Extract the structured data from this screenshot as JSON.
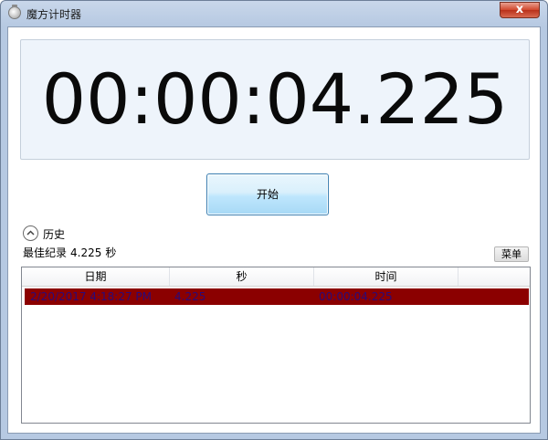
{
  "window": {
    "title": "魔方计时器",
    "close_glyph": "x"
  },
  "timer": {
    "display": "00:00:04.225"
  },
  "controls": {
    "start_label": "开始",
    "menu_label": "菜单"
  },
  "history": {
    "label": "历史",
    "best_prefix": "最佳纪录",
    "best_value": "4.225",
    "best_unit": "秒"
  },
  "table": {
    "columns": [
      "日期",
      "秒",
      "时间"
    ],
    "rows": [
      {
        "date": "2/20/2017 4:18:27 PM",
        "seconds": "4.225",
        "time": "00:00:04.225",
        "selected": true
      }
    ]
  },
  "colors": {
    "selected_row": "#8b0000",
    "timer_panel": "#eef4fb",
    "start_border": "#3c7fb1"
  }
}
